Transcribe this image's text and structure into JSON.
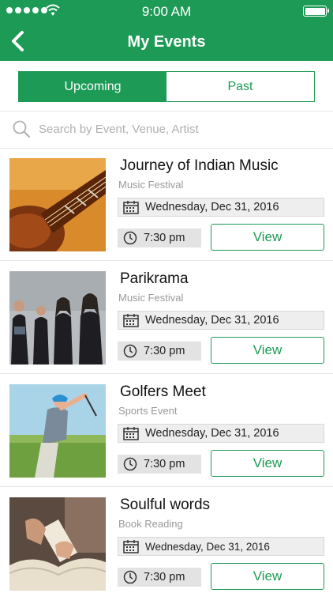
{
  "status_bar": {
    "time": "9:00 AM"
  },
  "header": {
    "title": "My Events"
  },
  "tabs": {
    "upcoming": "Upcoming",
    "past": "Past"
  },
  "search": {
    "placeholder": "Search by Event, Venue, Artist"
  },
  "colors": {
    "brand_green": "#1d9a56",
    "muted_text": "#999999",
    "placeholder": "#b0b0b0"
  },
  "events": [
    {
      "title": "Journey of Indian Music",
      "category": "Music Festival",
      "date": "Wednesday, Dec 31, 2016",
      "time": "7:30 pm",
      "view_label": "View",
      "image": "sitar-photo"
    },
    {
      "title": "Parikrama",
      "category": "Music Festival",
      "date": "Wednesday, Dec 31, 2016",
      "time": "7:30 pm",
      "view_label": "View",
      "image": "band-photo"
    },
    {
      "title": "Golfers Meet",
      "category": "Sports Event",
      "date": "Wednesday, Dec 31, 2016",
      "time": "7:30 pm",
      "view_label": "View",
      "image": "golfer-photo"
    },
    {
      "title": "Soulful words",
      "category": "Book Reading",
      "date": "Wednesday, Dec 31, 2016",
      "time": "7:30 pm",
      "view_label": "View",
      "image": "book-photo"
    }
  ]
}
